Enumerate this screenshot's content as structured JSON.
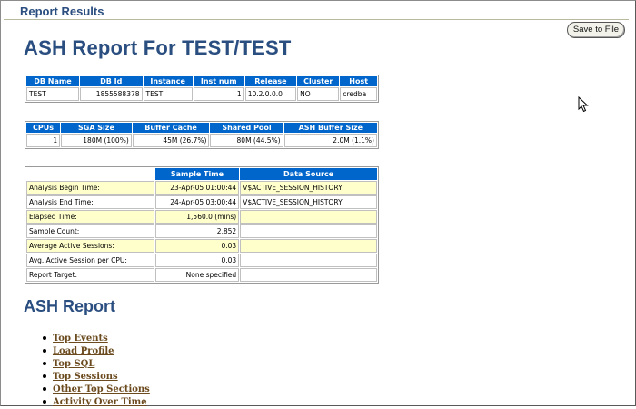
{
  "header": {
    "title": "Report Results",
    "save_label": "Save to File"
  },
  "report_title": "ASH Report For TEST/TEST",
  "db_table": {
    "headers": [
      "DB Name",
      "DB Id",
      "Instance",
      "Inst num",
      "Release",
      "Cluster",
      "Host"
    ],
    "row": [
      "TEST",
      "1855588378",
      "TEST",
      "1",
      "10.2.0.0.0",
      "NO",
      "credba"
    ]
  },
  "cpu_table": {
    "headers": [
      "CPUs",
      "SGA Size",
      "Buffer Cache",
      "Shared Pool",
      "ASH Buffer Size"
    ],
    "row": [
      "1",
      "180M (100%)",
      "45M (26.7%)",
      "80M (44.5%)",
      "2.0M (1.1%)"
    ]
  },
  "analysis_table": {
    "headers": [
      "",
      "Sample Time",
      "Data Source"
    ],
    "rows": [
      [
        "Analysis Begin Time:",
        "23-Apr-05 01:00:44",
        "V$ACTIVE_SESSION_HISTORY"
      ],
      [
        "Analysis End Time:",
        "24-Apr-05 03:00:44",
        "V$ACTIVE_SESSION_HISTORY"
      ],
      [
        "Elapsed Time:",
        "1,560.0 (mins)",
        ""
      ],
      [
        "Sample Count:",
        "2,852",
        ""
      ],
      [
        "Average Active Sessions:",
        "0.03",
        ""
      ],
      [
        "Avg. Active Session per CPU:",
        "0.03",
        ""
      ],
      [
        "Report Target:",
        "None specified",
        ""
      ]
    ]
  },
  "section_title": "ASH Report",
  "toc": [
    "Top Events",
    "Load Profile",
    "Top SQL",
    "Top Sessions",
    "Other Top Sections",
    "Activity Over Time"
  ],
  "icons": {
    "cursor": "mouse-pointer-icon"
  },
  "colors": {
    "header_blue": "#0066cc",
    "title_blue": "#2a4e80",
    "link_brown": "#6b4a1e",
    "row_yellow": "#ffffcc"
  }
}
